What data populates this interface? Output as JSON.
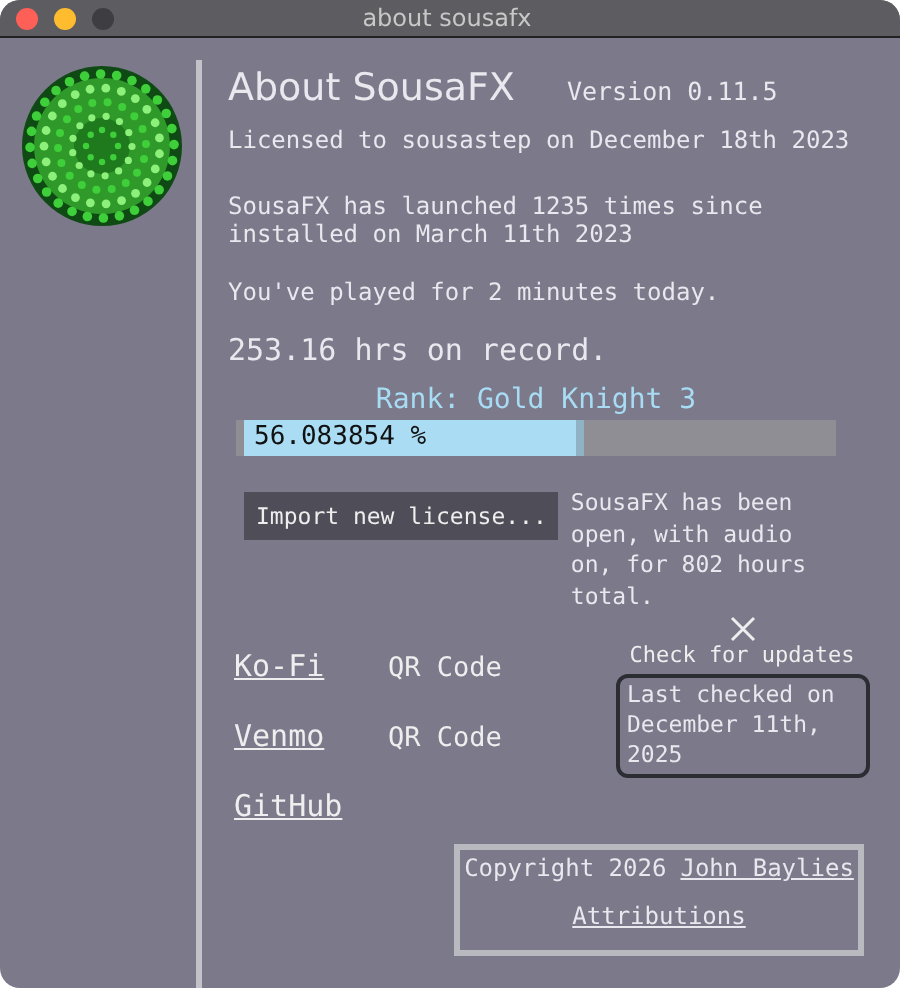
{
  "window": {
    "title": "about sousafx"
  },
  "heading": "About SousaFX",
  "version": "Version 0.11.5",
  "license": "Licensed to sousastep on December 18th 2023",
  "launches": "SousaFX has launched 1235 times since installed on March 11th 2023",
  "played_today": "You've played for 2 minutes today.",
  "hours": "253.16 hrs on record.",
  "rank": "Rank: Gold Knight 3",
  "progress": {
    "label": "56.083854 %",
    "level": 0.56
  },
  "import_button": "Import new license...",
  "open_hours": "SousaFX has been open, with audio on, for 802 hours total.",
  "links": [
    {
      "label": "Ko-Fi",
      "qr": "QR Code"
    },
    {
      "label": "Venmo",
      "qr": "QR Code"
    },
    {
      "label": "GitHub"
    }
  ],
  "updates": {
    "button": "Check for updates",
    "status": "Last checked on December 11th, 2025"
  },
  "copyright": {
    "text": "Copyright 2026",
    "author": "John Baylies",
    "attributions": "Attributions"
  }
}
